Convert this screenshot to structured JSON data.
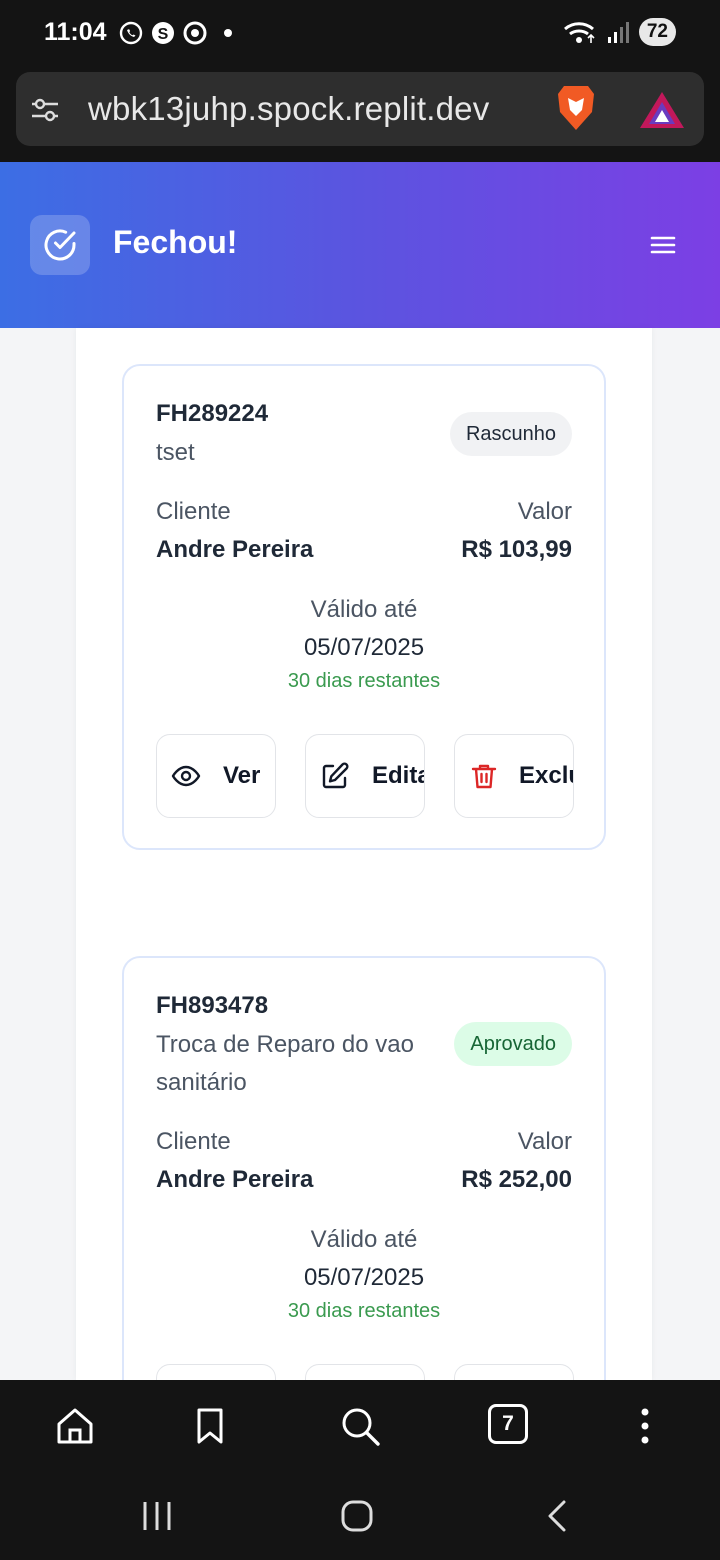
{
  "status_bar": {
    "time": "11:04",
    "battery": "72"
  },
  "browser": {
    "url": "wbk13juhp.spock.replit.dev",
    "tab_count": "7"
  },
  "app": {
    "title": "Fechou!"
  },
  "quotes": [
    {
      "code": "FH289224",
      "description": "tset",
      "status": "Rascunho",
      "client_label": "Cliente",
      "client": "Andre Pereira",
      "value_label": "Valor",
      "value": "R$ 103,99",
      "valid_label": "Válido até",
      "valid_date": "05/07/2025",
      "remaining": "30 dias restantes",
      "actions": {
        "view": "Ver",
        "edit": "Editar",
        "delete": "Excluir"
      }
    },
    {
      "code": "FH893478",
      "description_line1": "Troca de Reparo do vao",
      "description_line2": "sanitário",
      "status": "Aprovado",
      "client_label": "Cliente",
      "client": "Andre Pereira",
      "value_label": "Valor",
      "value": "R$ 252,00",
      "valid_label": "Válido até",
      "valid_date": "05/07/2025",
      "remaining": "30 dias restantes"
    }
  ],
  "colors": {
    "header_gradient_start": "#3c6ee4",
    "header_gradient_end": "#7c3fe4",
    "approved_bg": "#dcfce7",
    "approved_text": "#166534",
    "remaining_text": "#3a9a4f",
    "delete_icon": "#dc2626"
  }
}
